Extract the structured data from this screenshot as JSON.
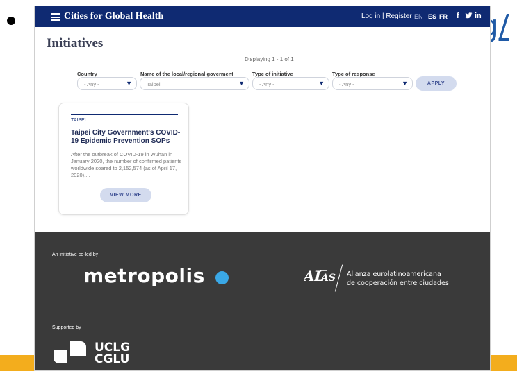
{
  "slide": {
    "bg_link_text": "g/",
    "stripe_color": "#f3ad1d"
  },
  "header": {
    "title": "Cities for Global Health",
    "login": "Log in | Register",
    "languages": [
      "EN",
      "ES",
      "FR"
    ],
    "social": {
      "facebook": "f",
      "twitter": "🐦",
      "linkedin": "in"
    }
  },
  "page": {
    "title": "Initiatives",
    "displaying": "Displaying 1 - 1 of 1"
  },
  "filters": [
    {
      "label": "Country",
      "value": "- Any -"
    },
    {
      "label": "Name of the local/regional goverment",
      "value": "Taipei"
    },
    {
      "label": "Type of initiative",
      "value": "- Any -"
    },
    {
      "label": "Type of response",
      "value": "- Any -"
    }
  ],
  "apply_label": "APPLY",
  "card": {
    "tag": "TAIPEI",
    "title": "Taipei City Government's COVID-19 Epidemic Prevention SOPs",
    "text": "After the outbreak of COVID-19 in Wuhan in January 2020, the number of confirmed patients worldwide soared to 2,152,574 (as of April 17, 2020)....",
    "button": "VIEW MORE"
  },
  "footer": {
    "co_led": "An initiative co-led by",
    "metropolis": "metropolis",
    "allas_logo": "AL LAS",
    "allas_line1": "Alianza eurolatinoamericana",
    "allas_line2": "de cooperación entre ciudades",
    "supported": "Supported by",
    "uclg_line1": "UCLG",
    "uclg_line2": "CGLU"
  },
  "colors": {
    "header_bg": "#0f2a72",
    "footer_bg": "#3a3a3a",
    "button_bg": "#d3dbee",
    "metropolis_dot": "#3aa8e6"
  }
}
